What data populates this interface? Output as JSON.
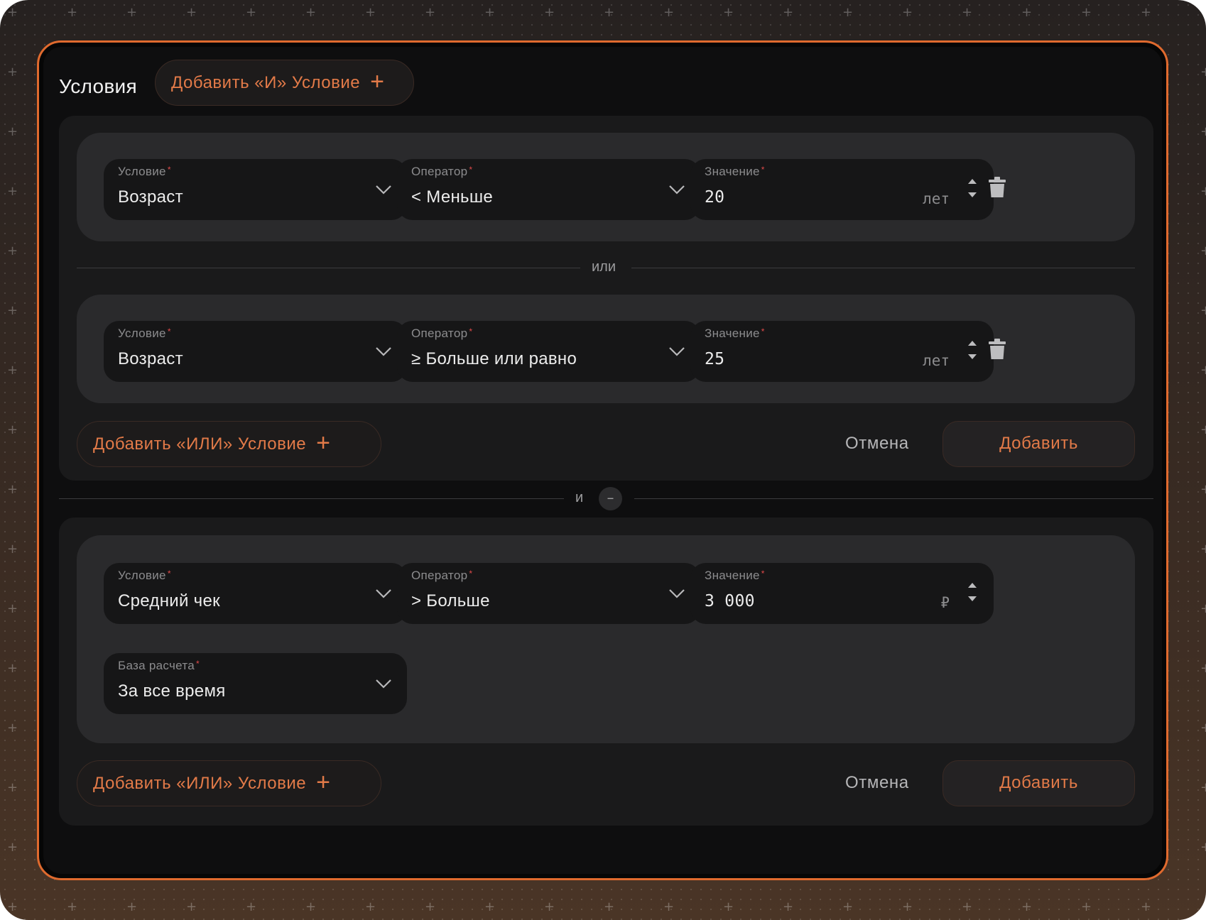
{
  "header": {
    "title": "Условия",
    "add_and_label": "Добавить «И» Условие"
  },
  "groups": [
    {
      "rows": [
        {
          "condition": {
            "label": "Условие",
            "value": "Возраст"
          },
          "operator": {
            "label": "Оператор",
            "value": "< Меньше"
          },
          "value": {
            "label": "Значение",
            "value": "20",
            "unit": "лет"
          }
        },
        {
          "condition": {
            "label": "Условие",
            "value": "Возраст"
          },
          "operator": {
            "label": "Оператор",
            "value": "≥ Больше или равно"
          },
          "value": {
            "label": "Значение",
            "value": "25",
            "unit": "лет"
          }
        }
      ],
      "or_separator": "или",
      "add_or_label": "Добавить «ИЛИ» Условие",
      "cancel_label": "Отмена",
      "add_label": "Добавить"
    },
    {
      "rows": [
        {
          "condition": {
            "label": "Условие",
            "value": "Средний чек"
          },
          "operator": {
            "label": "Оператор",
            "value": "> Больше"
          },
          "value": {
            "label": "Значение",
            "value": "3 000",
            "unit": "₽"
          },
          "base": {
            "label": "База расчета",
            "value": "За все время"
          }
        }
      ],
      "add_or_label": "Добавить «ИЛИ» Условие",
      "cancel_label": "Отмена",
      "add_label": "Добавить"
    }
  ],
  "and_separator": "и",
  "remove_and_symbol": "–",
  "required_mark": "*",
  "colors": {
    "accent": "#e06a2e",
    "accent_text": "#e27a48",
    "required": "#e04a4a"
  }
}
